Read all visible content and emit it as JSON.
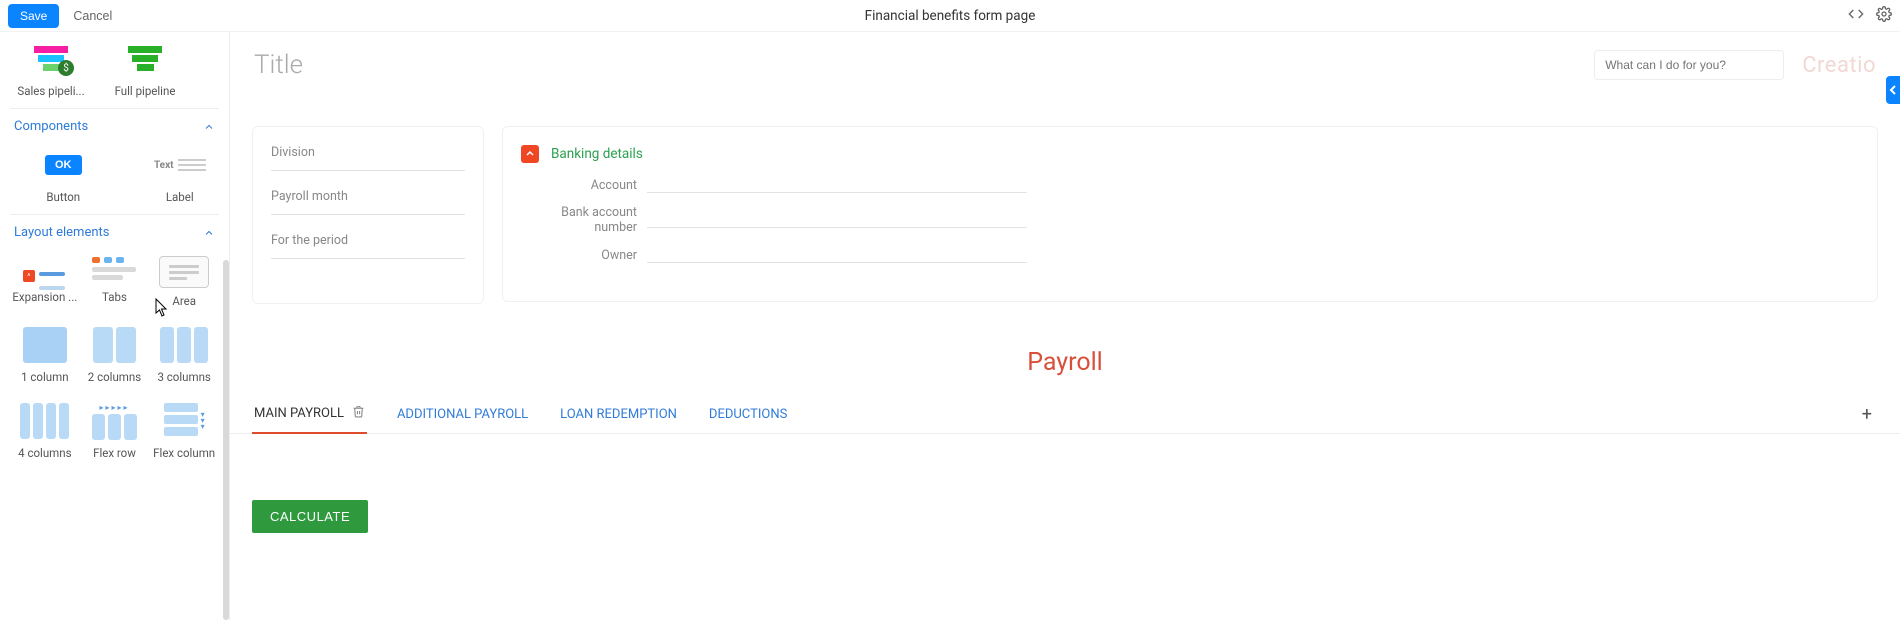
{
  "topbar": {
    "save": "Save",
    "cancel": "Cancel",
    "title": "Financial benefits form page"
  },
  "side": {
    "widgets": [
      {
        "id": "sales-pipeline",
        "label": "Sales pipeli..."
      },
      {
        "id": "full-pipeline",
        "label": "Full pipeline"
      }
    ],
    "sections": {
      "components": {
        "title": "Components",
        "items": [
          {
            "id": "button",
            "label": "Button",
            "sample_text": "OK"
          },
          {
            "id": "label",
            "label": "Label",
            "sample_text": "Text"
          }
        ]
      },
      "layout": {
        "title": "Layout elements",
        "items": [
          {
            "id": "expansion",
            "label": "Expansion ..."
          },
          {
            "id": "tabs",
            "label": "Tabs"
          },
          {
            "id": "area",
            "label": "Area"
          },
          {
            "id": "col1",
            "label": "1 column"
          },
          {
            "id": "col2",
            "label": "2 columns"
          },
          {
            "id": "col3",
            "label": "3 columns"
          },
          {
            "id": "col4",
            "label": "4 columns"
          },
          {
            "id": "flexrow",
            "label": "Flex row"
          },
          {
            "id": "flexcol",
            "label": "Flex column"
          }
        ]
      }
    }
  },
  "canvas": {
    "title": "Title",
    "search_placeholder": "What can I do for you?",
    "logo": "Creatio",
    "left_card": {
      "fields": [
        {
          "label": "Division"
        },
        {
          "label": "Payroll month"
        },
        {
          "label": "For the period"
        }
      ]
    },
    "right_card": {
      "title": "Banking details",
      "fields": [
        {
          "label": "Account"
        },
        {
          "label": "Bank account number"
        },
        {
          "label": "Owner"
        }
      ]
    },
    "section_title": "Payroll",
    "tabs": [
      {
        "label": "MAIN PAYROLL",
        "active": true
      },
      {
        "label": "ADDITIONAL PAYROLL"
      },
      {
        "label": "LOAN REDEMPTION"
      },
      {
        "label": "DEDUCTIONS"
      }
    ],
    "calculate": "CALCULATE"
  }
}
